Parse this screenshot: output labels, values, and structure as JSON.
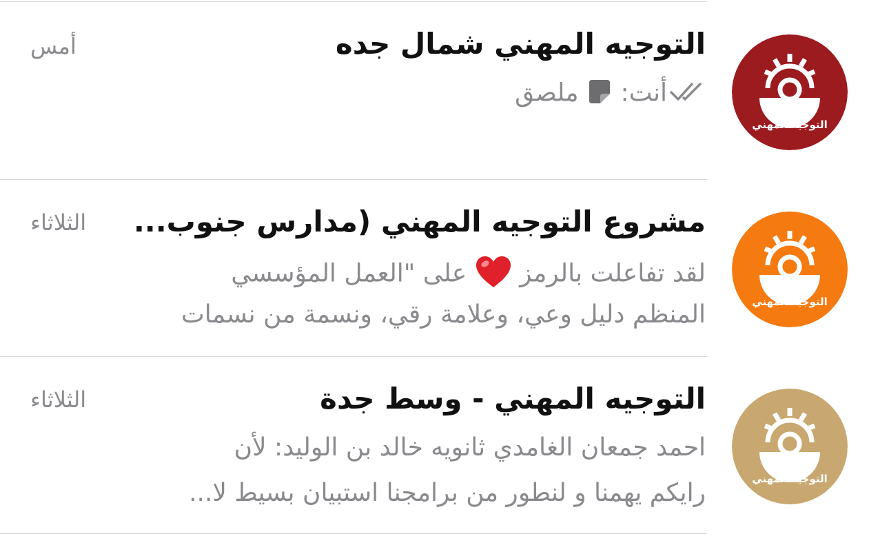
{
  "avatar_label": "التوجيه المهني",
  "chats": [
    {
      "title": "التوجيه المهني شمال جده",
      "time": "أمس",
      "sender": "أنت:",
      "preview": "ملصق",
      "avatar_color": "#9c1b1f",
      "status_icon": "double-check-icon",
      "attachment_icon": "sticker-icon"
    },
    {
      "title": "مشروع التوجيه المهني (مدارس جنوب...",
      "time": "الثلاثاء",
      "preview_line1_a": "لقد تفاعلت بالرمز",
      "preview_line1_b": "على \"العمل المؤسسي",
      "preview_line2": "المنظم دليل وعي، وعلامة رقي، ونسمة من نسمات",
      "reaction_icon": "red-heart-icon",
      "avatar_color": "#f57a10"
    },
    {
      "title": "التوجيه المهني - وسط جدة",
      "time": "الثلاثاء",
      "preview_line1": "احمد جمعان الغامدي ثانويه خالد بن الوليد: لأن",
      "preview_line2": "رايكم يهمنا  و لنطور من برامجنا  استبيان بسيط لا...",
      "avatar_color": "#c8a870"
    }
  ]
}
